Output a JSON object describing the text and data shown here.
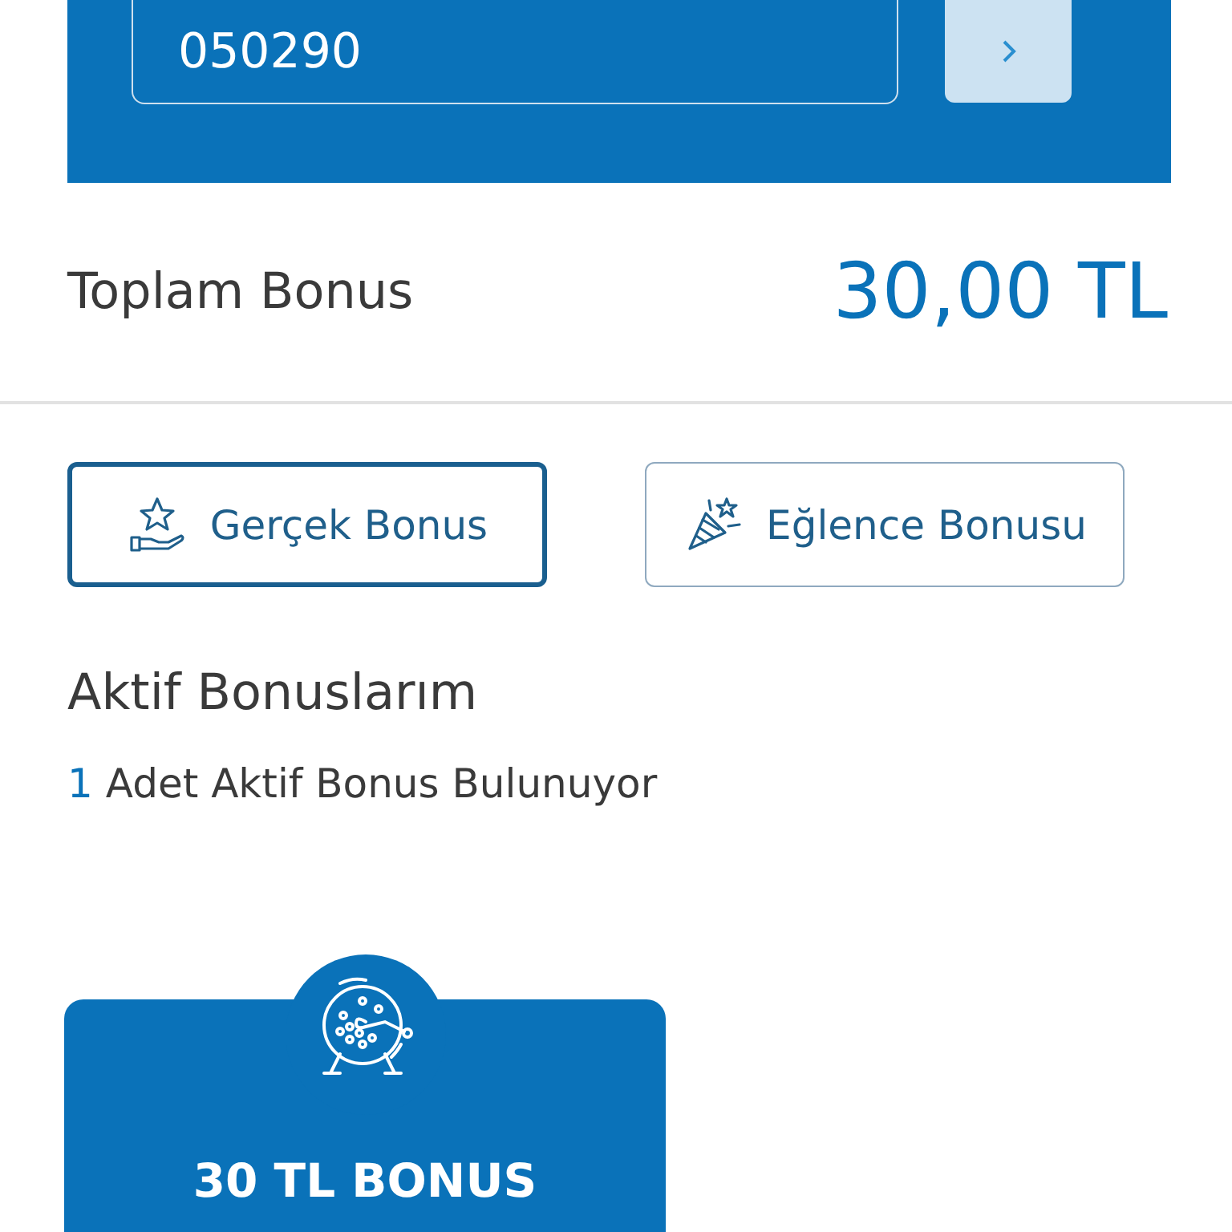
{
  "code_entry": {
    "value": "050290"
  },
  "total": {
    "label": "Toplam Bonus",
    "amount": "30,00 TL"
  },
  "bonus_types": [
    {
      "label": "Gerçek Bonus",
      "selected": true
    },
    {
      "label": "Eğlence Bonusu",
      "selected": false
    }
  ],
  "active": {
    "title": "Aktif Bonuslarım",
    "count": "1",
    "text": "Adet Aktif Bonus Bulunuyor"
  },
  "bonus_cards": [
    {
      "title": "30 TL BONUS"
    }
  ]
}
